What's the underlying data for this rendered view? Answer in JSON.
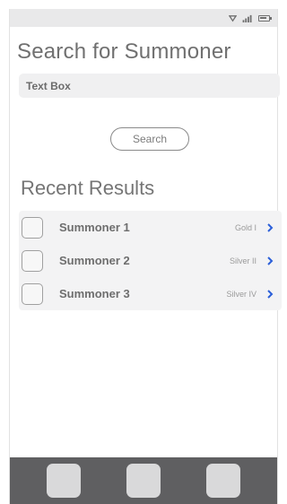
{
  "status_bar": {
    "icons": [
      "wifi-icon",
      "signal-icon",
      "battery-icon"
    ]
  },
  "page_title": "Search for Summoner",
  "search": {
    "textbox_value": "Text Box",
    "button_label": "Search"
  },
  "recent": {
    "title": "Recent Results",
    "items": [
      {
        "name": "Summoner 1",
        "rank": "Gold I"
      },
      {
        "name": "Summoner 2",
        "rank": "Silver II"
      },
      {
        "name": "Summoner 3",
        "rank": "Silver IV"
      }
    ]
  },
  "nav": {
    "buttons": [
      "nav-button-left",
      "nav-button-center",
      "nav-button-right"
    ]
  },
  "colors": {
    "status_bar": "#e9e9ea",
    "nav_bar": "#5f5f61",
    "chevron": "#2b5fd9",
    "text": "#707070"
  }
}
